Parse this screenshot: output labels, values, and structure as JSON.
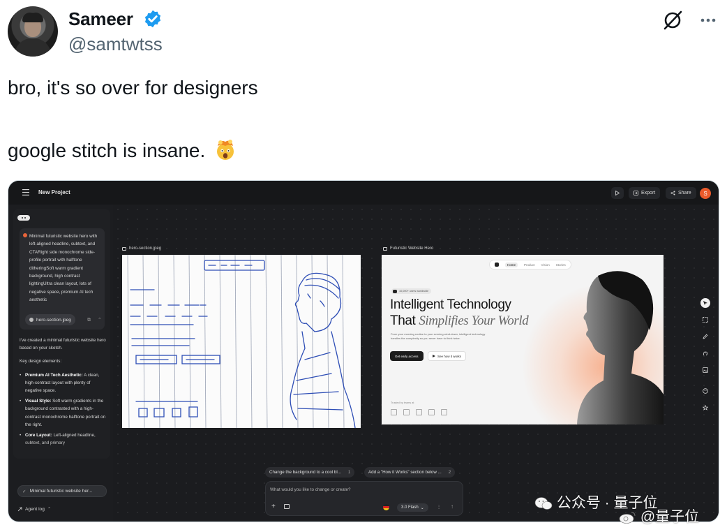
{
  "tweet": {
    "author_name": "Sameer",
    "author_handle": "@samtwtss",
    "line1": "bro, it's so over for designers",
    "line2": "google stitch is insane.",
    "emoji": "exploding-head-emoji"
  },
  "stitch_app": {
    "project_title": "New Project",
    "toolbar": {
      "export_label": "Export",
      "share_label": "Share",
      "user_initial": "S"
    },
    "prompt": {
      "text": "Minimal futuristic website hero with left-aligned headline, subtext, and CTARight side monochrome side-profile portrait with halftone ditheringSoft warm gradient background, high contrast lightingUltra clean layout, lots of negative space, premium AI tech aesthetic",
      "attachment": "hero-section.jpeg"
    },
    "response": {
      "intro": "I've created a minimal futuristic website hero based on your sketch.",
      "key_heading": "Key design elements:",
      "items": [
        {
          "title": "Premium AI Tech Aesthetic:",
          "text": " A clean, high-contrast layout with plenty of negative space."
        },
        {
          "title": "Visual Style:",
          "text": " Soft warm gradients in the background contrasted with a high-contrast monochrome halftone portrait on the right."
        },
        {
          "title": "Core Layout:",
          "text": " Left-aligned headline, subtext, and primary"
        }
      ]
    },
    "history_chip": "Minimal futuristic website her...",
    "agent_log": "Agent log",
    "frames": {
      "sketch_label": "hero-section.jpeg",
      "hero_label": "Futuristic Website Hero"
    },
    "hero": {
      "nav": [
        "Home",
        "Product",
        "Vision",
        "Stories"
      ],
      "badge": "10,000+ users worldwide",
      "headline_line1": "Intelligent Technology",
      "headline_line2_plain": "That",
      "headline_line2_italic": "Simplifies Your World",
      "subtext": "From your morning routine to your evening wind-down, intelligent technology handles the complexity so you never have to think twice.",
      "cta_primary": "Get early access",
      "cta_secondary": "See how it works",
      "trusted": "Trusted by teams at"
    },
    "suggestions": [
      {
        "label": "Change the background to a cool bl...",
        "num": "1"
      },
      {
        "label": "Add a \"How it Works\" section below ...",
        "num": "2"
      }
    ],
    "input_placeholder": "What would you like to change or create?",
    "model_label": "3.0 Flash"
  },
  "watermark": {
    "line1": "公众号 · 量子位",
    "line2": "@量子位"
  },
  "colors": {
    "verified_blue": "#1d9bf0",
    "app_bg": "#1c1d20",
    "accent_orange": "#ea5a2b"
  }
}
